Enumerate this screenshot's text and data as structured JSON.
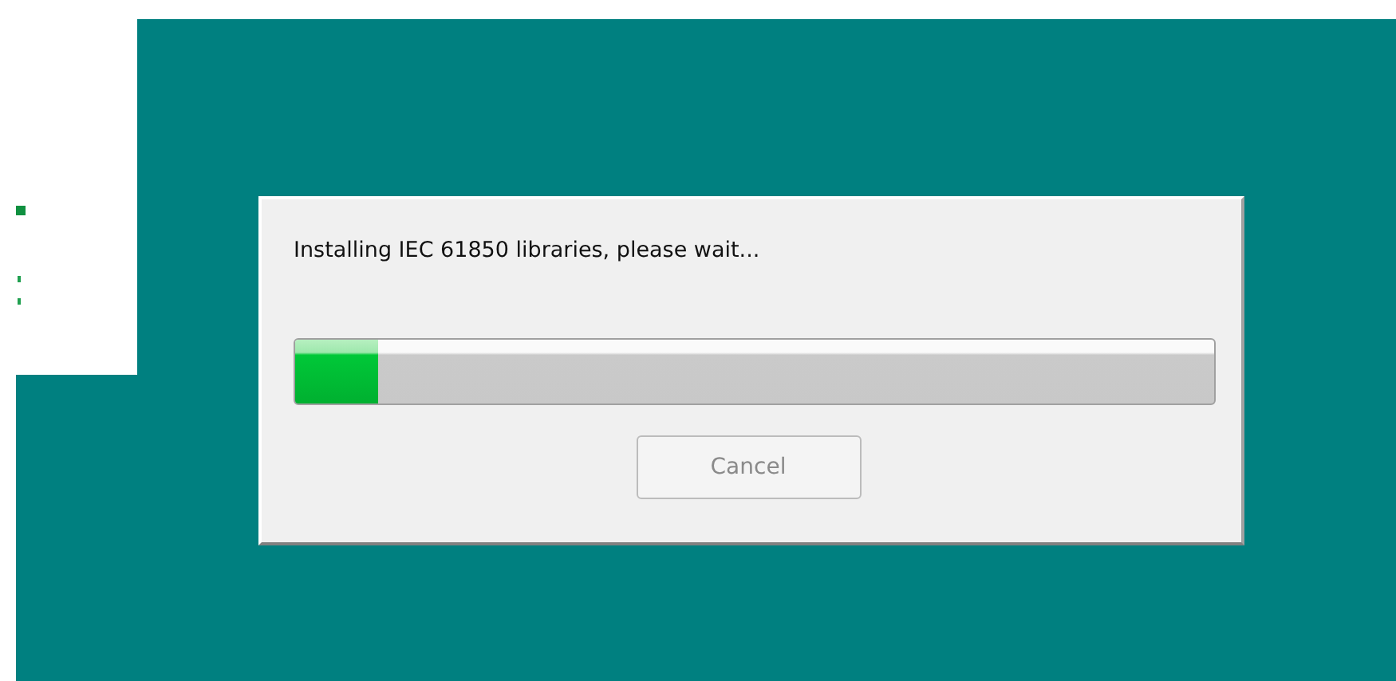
{
  "dialog": {
    "message": "Installing IEC 61850 libraries, please wait...",
    "progress": {
      "level": 0.09
    },
    "buttons": [
      {
        "label": "Cancel",
        "disabled": true
      }
    ]
  }
}
